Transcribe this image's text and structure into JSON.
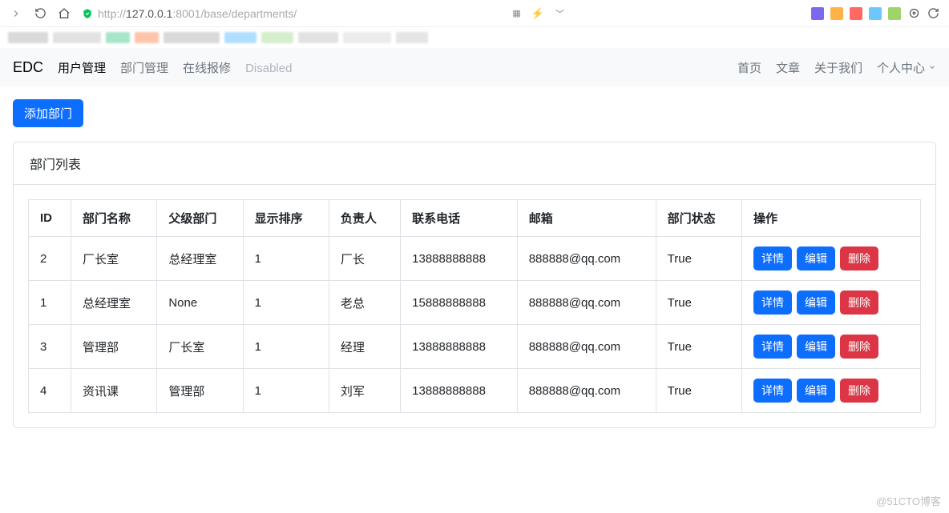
{
  "browser": {
    "url_prefix": "http://",
    "url_host": "127.0.0.1",
    "url_port": ":8001",
    "url_path": "/base/departments/"
  },
  "navbar": {
    "brand": "EDC",
    "left": [
      {
        "label": "用户管理",
        "state": "active"
      },
      {
        "label": "部门管理",
        "state": ""
      },
      {
        "label": "在线报修",
        "state": ""
      },
      {
        "label": "Disabled",
        "state": "disabled"
      }
    ],
    "right": [
      {
        "label": "首页"
      },
      {
        "label": "文章"
      },
      {
        "label": "关于我们"
      },
      {
        "label": "个人中心",
        "dropdown": true
      }
    ]
  },
  "page": {
    "add_button": "添加部门",
    "card_title": "部门列表"
  },
  "table": {
    "headers": [
      "ID",
      "部门名称",
      "父级部门",
      "显示排序",
      "负责人",
      "联系电话",
      "邮箱",
      "部门状态",
      "操作"
    ],
    "rows": [
      {
        "id": "2",
        "name": "厂长室",
        "parent": "总经理室",
        "order": "1",
        "leader": "厂长",
        "phone": "13888888888",
        "email": "888888@qq.com",
        "status": "True"
      },
      {
        "id": "1",
        "name": "总经理室",
        "parent": "None",
        "order": "1",
        "leader": "老总",
        "phone": "15888888888",
        "email": "888888@qq.com",
        "status": "True"
      },
      {
        "id": "3",
        "name": "管理部",
        "parent": "厂长室",
        "order": "1",
        "leader": "经理",
        "phone": "13888888888",
        "email": "888888@qq.com",
        "status": "True"
      },
      {
        "id": "4",
        "name": "资讯课",
        "parent": "管理部",
        "order": "1",
        "leader": "刘军",
        "phone": "13888888888",
        "email": "888888@qq.com",
        "status": "True"
      }
    ],
    "actions": {
      "detail": "详情",
      "edit": "编辑",
      "delete": "删除"
    }
  },
  "watermark": "@51CTO博客"
}
